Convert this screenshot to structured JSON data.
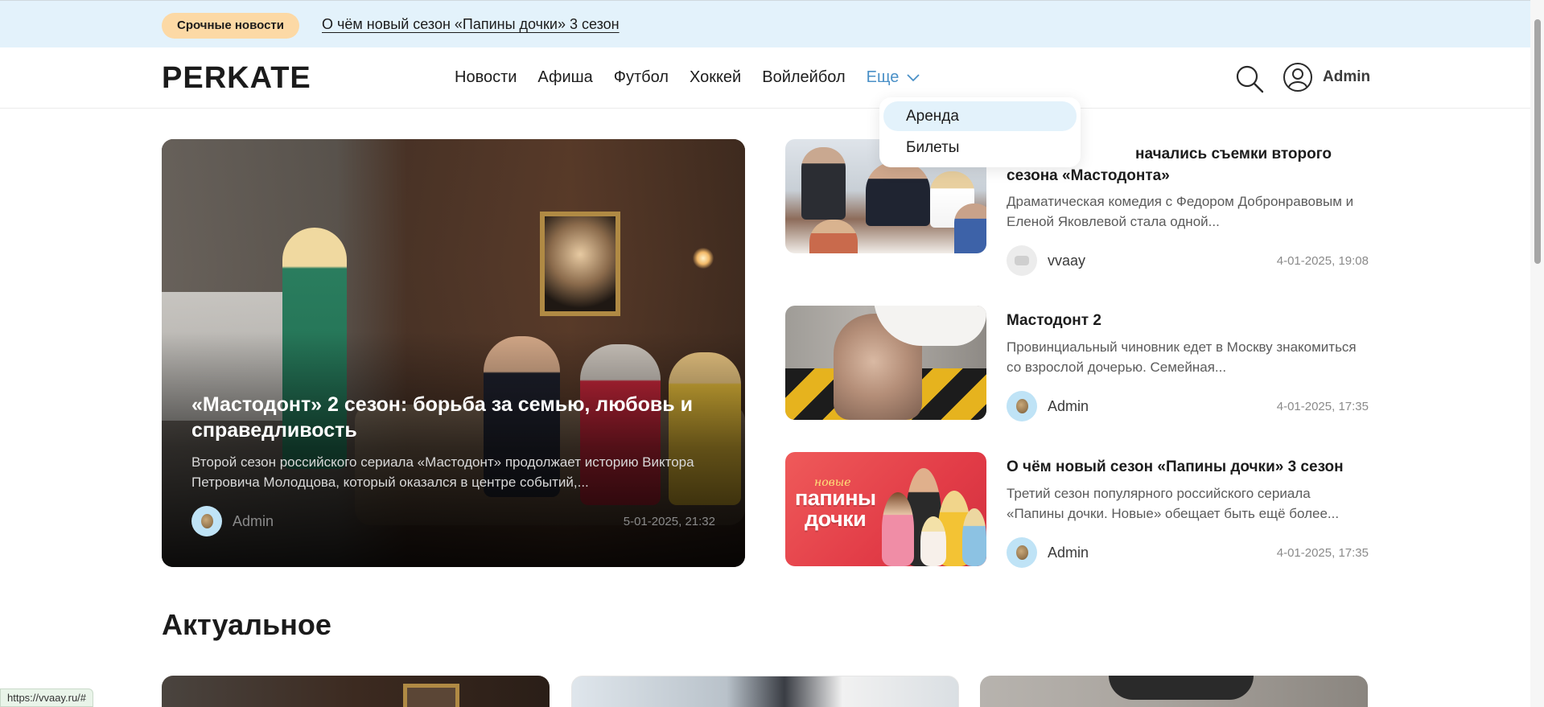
{
  "breaking": {
    "badge": "Срочные новости",
    "headline": "О чём новый сезон «Папины дочки» 3 сезон"
  },
  "header": {
    "logo": "PERKATE",
    "nav": [
      "Новости",
      "Афиша",
      "Футбол",
      "Хоккей",
      "Войлейбол"
    ],
    "more_label": "Еще",
    "user_name": "Admin"
  },
  "dropdown": {
    "items": [
      "Аренда",
      "Билеты"
    ]
  },
  "hero": {
    "title": "«Мастодонт» 2 сезон: борьба за семью, любовь и справедливость",
    "description": "Второй сезон российского сериала «Мастодонт» продолжает историю Виктора Петровича Молодцова, который оказался в центре событий,...",
    "author": "Admin",
    "date": "5-01-2025, 21:32"
  },
  "news": [
    {
      "title": "начались съемки второго сезона «Мастодонта»",
      "description": "Драматическая комедия с Федором Добронравовым и Еленой Яковлевой стала одной...",
      "author": "vvaay",
      "date": "4-01-2025, 19:08"
    },
    {
      "title": "Мастодонт 2",
      "description": "Провинциальный чиновник едет в Москву знакомиться со взрослой дочерью. Семейная...",
      "author": "Admin",
      "date": "4-01-2025, 17:35"
    },
    {
      "title": "О чём новый сезон «Папины дочки» 3 сезон",
      "description": "Третий сезон популярного российского сериала «Папины дочки. Новые» обещает быть ещё более...",
      "author": "Admin",
      "date": "4-01-2025, 17:35",
      "thumb_logo_top": "новые",
      "thumb_logo_line1": "папины",
      "thumb_logo_line2": "дочки"
    }
  ],
  "section": {
    "title": "Актуальное"
  },
  "status_url": "https://vvaay.ru/#",
  "colors": {
    "accent": "#4a90c7",
    "breaking_bg": "#e3f2fb",
    "badge_bg": "#fcd9a5"
  }
}
